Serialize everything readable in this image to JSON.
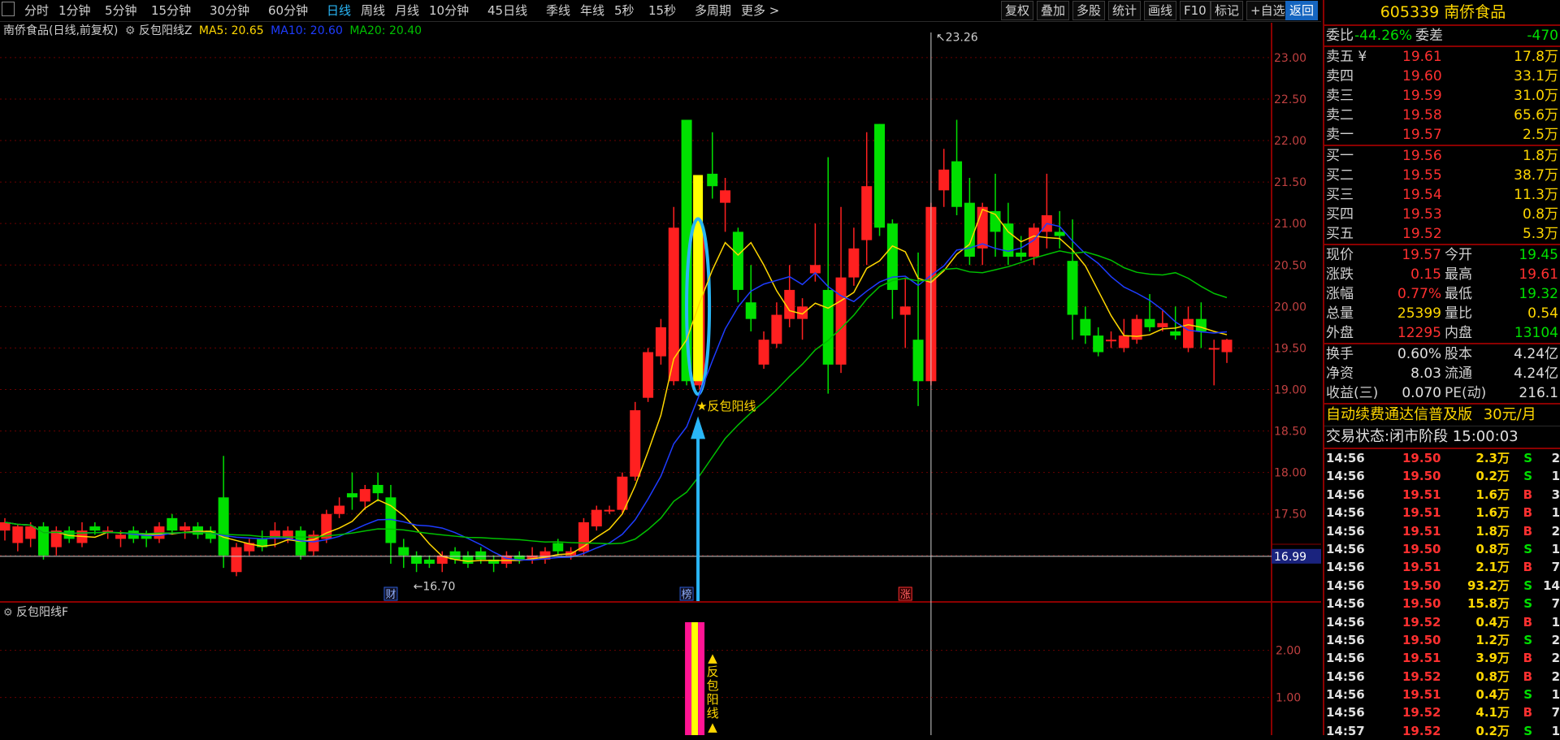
{
  "toolbar": {
    "periods": [
      "分时",
      "1分钟",
      "5分钟",
      "15分钟",
      "30分钟",
      "60分钟",
      "日线",
      "周线",
      "月线",
      "10分钟",
      "45日线",
      "季线",
      "年线",
      "5秒",
      "15秒",
      "多周期",
      "更多 >"
    ],
    "active_period": "日线",
    "right_buttons": [
      "复权",
      "叠加",
      "多股",
      "统计",
      "画线",
      "F10",
      "标记",
      "+自选",
      "返回"
    ]
  },
  "chart_header": {
    "stock": "南侨食品(日线,前复权)",
    "indicator": "反包阳线Z",
    "ma5": "MA5: 20.65",
    "ma10": "MA10: 20.60",
    "ma20": "MA20: 20.40"
  },
  "sub_header": {
    "indicator": "反包阳线F"
  },
  "colors": {
    "up": "#ff2020",
    "down": "#00e000",
    "ma5": "#ffd700",
    "ma10": "#1e3cff",
    "ma20": "#00c000",
    "signal": "#ffff00",
    "accent": "#29b6f6",
    "grid": "#6a0000"
  },
  "chart_data": {
    "type": "candlestick",
    "y_axis_ticks": [
      "23.00",
      "22.50",
      "22.00",
      "21.50",
      "21.00",
      "20.50",
      "20.00",
      "19.50",
      "19.00",
      "18.50",
      "18.00",
      "17.50",
      "17.00"
    ],
    "ylim": [
      16.45,
      23.4
    ],
    "current_price_tag": "16.99",
    "annotations": {
      "high": "23.26",
      "low": "16.70",
      "signal": "反包阳线"
    },
    "event_markers": [
      "财",
      "榜",
      "涨"
    ],
    "candles": [
      [
        17.3,
        17.4,
        17.18,
        17.45
      ],
      [
        17.15,
        17.35,
        17.05,
        17.38
      ],
      [
        17.2,
        17.35,
        17.1,
        17.4
      ],
      [
        17.35,
        17.0,
        16.95,
        17.4
      ],
      [
        17.1,
        17.3,
        17.0,
        17.35
      ],
      [
        17.3,
        17.2,
        17.15,
        17.35
      ],
      [
        17.15,
        17.3,
        17.1,
        17.4
      ],
      [
        17.35,
        17.3,
        17.25,
        17.4
      ],
      [
        17.3,
        17.3,
        17.2,
        17.35
      ],
      [
        17.2,
        17.25,
        17.1,
        17.3
      ],
      [
        17.3,
        17.2,
        17.15,
        17.35
      ],
      [
        17.25,
        17.2,
        17.1,
        17.3
      ],
      [
        17.2,
        17.35,
        17.15,
        17.4
      ],
      [
        17.45,
        17.3,
        17.25,
        17.5
      ],
      [
        17.3,
        17.35,
        17.2,
        17.4
      ],
      [
        17.35,
        17.25,
        17.2,
        17.4
      ],
      [
        17.3,
        17.2,
        17.15,
        17.35
      ],
      [
        17.7,
        17.0,
        16.85,
        18.2
      ],
      [
        16.8,
        17.1,
        16.75,
        17.15
      ],
      [
        17.05,
        17.15,
        17.0,
        17.2
      ],
      [
        17.2,
        17.1,
        17.05,
        17.3
      ],
      [
        17.2,
        17.3,
        17.1,
        17.4
      ],
      [
        17.2,
        17.3,
        17.15,
        17.35
      ],
      [
        17.3,
        17.0,
        16.95,
        17.35
      ],
      [
        17.05,
        17.25,
        17.0,
        17.3
      ],
      [
        17.2,
        17.5,
        17.15,
        17.55
      ],
      [
        17.5,
        17.6,
        17.45,
        17.7
      ],
      [
        17.75,
        17.7,
        17.55,
        18.0
      ],
      [
        17.65,
        17.8,
        17.55,
        17.85
      ],
      [
        17.85,
        17.75,
        17.65,
        18.0
      ],
      [
        17.7,
        17.15,
        16.9,
        17.85
      ],
      [
        17.1,
        17.0,
        16.85,
        17.2
      ],
      [
        17.0,
        16.9,
        16.8,
        17.05
      ],
      [
        16.95,
        16.9,
        16.85,
        17.0
      ],
      [
        16.9,
        17.0,
        16.8,
        17.05
      ],
      [
        17.05,
        16.95,
        16.9,
        17.1
      ],
      [
        17.0,
        16.9,
        16.85,
        17.05
      ],
      [
        17.05,
        16.95,
        16.9,
        17.1
      ],
      [
        16.95,
        16.9,
        16.8,
        17.0
      ],
      [
        16.9,
        17.0,
        16.85,
        17.05
      ],
      [
        17.0,
        16.95,
        16.9,
        17.05
      ],
      [
        16.95,
        17.0,
        16.9,
        17.1
      ],
      [
        16.95,
        17.05,
        16.9,
        17.1
      ],
      [
        17.15,
        17.05,
        17.0,
        17.2
      ],
      [
        17.0,
        17.05,
        16.95,
        17.1
      ],
      [
        17.05,
        17.4,
        17.0,
        17.45
      ],
      [
        17.35,
        17.55,
        17.3,
        17.6
      ],
      [
        17.55,
        17.55,
        17.5,
        17.6
      ],
      [
        17.55,
        17.95,
        17.5,
        18.0
      ],
      [
        17.95,
        18.75,
        17.9,
        18.85
      ],
      [
        18.9,
        19.45,
        18.85,
        19.5
      ],
      [
        19.4,
        19.75,
        19.3,
        19.85
      ],
      [
        19.1,
        20.95,
        19.05,
        21.2
      ],
      [
        22.25,
        19.1,
        19.05,
        22.25
      ],
      [
        19.05,
        20.95,
        19.0,
        20.95
      ],
      [
        21.6,
        21.45,
        21.3,
        22.1
      ],
      [
        21.25,
        21.4,
        20.9,
        21.55
      ],
      [
        20.9,
        20.2,
        20.05,
        20.95
      ],
      [
        20.05,
        19.85,
        19.7,
        20.5
      ],
      [
        19.3,
        19.6,
        19.25,
        19.7
      ],
      [
        19.55,
        19.9,
        19.5,
        20.05
      ],
      [
        19.85,
        20.2,
        19.75,
        20.5
      ],
      [
        19.85,
        20.0,
        19.6,
        20.1
      ],
      [
        20.4,
        20.5,
        20.3,
        21.0
      ],
      [
        20.2,
        19.3,
        18.95,
        21.8
      ],
      [
        19.3,
        20.35,
        19.2,
        21.2
      ],
      [
        20.35,
        20.7,
        20.25,
        20.95
      ],
      [
        20.8,
        21.45,
        20.5,
        22.1
      ],
      [
        22.2,
        20.95,
        20.85,
        22.2
      ],
      [
        21.0,
        20.2,
        19.85,
        21.05
      ],
      [
        19.9,
        20.0,
        19.5,
        20.35
      ],
      [
        19.6,
        19.1,
        18.8,
        20.65
      ],
      [
        19.1,
        21.2,
        19.05,
        21.25
      ],
      [
        21.4,
        21.65,
        21.2,
        21.9
      ],
      [
        21.75,
        21.2,
        21.1,
        22.25
      ],
      [
        21.25,
        20.6,
        20.5,
        21.55
      ],
      [
        20.7,
        21.2,
        20.5,
        21.25
      ],
      [
        21.15,
        20.9,
        20.6,
        21.6
      ],
      [
        21.0,
        20.6,
        20.5,
        21.25
      ],
      [
        20.65,
        20.6,
        20.55,
        20.85
      ],
      [
        20.6,
        20.95,
        20.5,
        21.0
      ],
      [
        20.9,
        21.1,
        20.7,
        21.6
      ],
      [
        20.9,
        20.85,
        20.7,
        21.15
      ],
      [
        20.55,
        19.9,
        19.6,
        21.05
      ],
      [
        19.85,
        19.65,
        19.55,
        20.0
      ],
      [
        19.65,
        19.45,
        19.4,
        19.75
      ],
      [
        19.6,
        19.6,
        19.5,
        19.7
      ],
      [
        19.5,
        19.65,
        19.45,
        19.85
      ],
      [
        19.6,
        19.85,
        19.55,
        19.9
      ],
      [
        19.85,
        19.75,
        19.7,
        20.15
      ],
      [
        19.75,
        19.8,
        19.7,
        19.95
      ],
      [
        19.7,
        19.65,
        19.6,
        20.0
      ],
      [
        19.5,
        19.85,
        19.45,
        20.0
      ],
      [
        19.85,
        19.7,
        19.5,
        20.05
      ],
      [
        19.5,
        19.5,
        19.05,
        19.6
      ],
      [
        19.45,
        19.6,
        19.32,
        19.61
      ]
    ],
    "sub_axis_ticks": [
      "2.00",
      "1.00"
    ],
    "sub_signal_label": "▲反包阳线▲"
  },
  "quote": {
    "code": "605339",
    "name": "南侨食品",
    "weibi_label": "委比",
    "weibi": "-44.26%",
    "weicha_label": "委差",
    "weicha": "-470",
    "sells": [
      {
        "label": "卖五",
        "mark": "¥",
        "price": "19.61",
        "vol": "17.8万"
      },
      {
        "label": "卖四",
        "price": "19.60",
        "vol": "33.1万"
      },
      {
        "label": "卖三",
        "price": "19.59",
        "vol": "31.0万"
      },
      {
        "label": "卖二",
        "price": "19.58",
        "vol": "65.6万"
      },
      {
        "label": "卖一",
        "price": "19.57",
        "vol": "2.5万"
      }
    ],
    "buys": [
      {
        "label": "买一",
        "price": "19.56",
        "vol": "1.8万"
      },
      {
        "label": "买二",
        "price": "19.55",
        "vol": "38.7万"
      },
      {
        "label": "买三",
        "price": "19.54",
        "vol": "11.3万"
      },
      {
        "label": "买四",
        "price": "19.53",
        "vol": "0.8万"
      },
      {
        "label": "买五",
        "price": "19.52",
        "vol": "5.3万"
      }
    ],
    "stats": [
      {
        "l1": "现价",
        "v1": "19.57",
        "c1": "red",
        "l2": "今开",
        "v2": "19.45",
        "c2": "green"
      },
      {
        "l1": "涨跌",
        "v1": "0.15",
        "c1": "red",
        "l2": "最高",
        "v2": "19.61",
        "c2": "red"
      },
      {
        "l1": "涨幅",
        "v1": "0.77%",
        "c1": "red",
        "l2": "最低",
        "v2": "19.32",
        "c2": "green"
      },
      {
        "l1": "总量",
        "v1": "25399",
        "c1": "yellow",
        "l2": "量比",
        "v2": "0.54",
        "c2": "yellow"
      },
      {
        "l1": "外盘",
        "v1": "12295",
        "c1": "red",
        "l2": "内盘",
        "v2": "13104",
        "c2": "green"
      }
    ],
    "stats2": [
      {
        "l1": "换手",
        "v1": "0.60%",
        "l2": "股本",
        "v2": "4.24亿"
      },
      {
        "l1": "净资",
        "v1": "8.03",
        "l2": "流通",
        "v2": "4.24亿"
      },
      {
        "l1": "收益(三)",
        "v1": "0.070",
        "l2": "PE(动)",
        "v2": "216.1"
      }
    ],
    "promo": "自动续费通达信普及版",
    "promo_price": "30元/月",
    "status": "交易状态:闭市阶段 15:00:03"
  },
  "ticks": [
    {
      "t": "14:56",
      "p": "19.50",
      "v": "2.3万",
      "s": "S",
      "n": "2"
    },
    {
      "t": "14:56",
      "p": "19.50",
      "v": "0.2万",
      "s": "S",
      "n": "1"
    },
    {
      "t": "14:56",
      "p": "19.51",
      "v": "1.6万",
      "s": "B",
      "n": "3"
    },
    {
      "t": "14:56",
      "p": "19.51",
      "v": "1.6万",
      "s": "B",
      "n": "1"
    },
    {
      "t": "14:56",
      "p": "19.51",
      "v": "1.8万",
      "s": "B",
      "n": "2"
    },
    {
      "t": "14:56",
      "p": "19.50",
      "v": "0.8万",
      "s": "S",
      "n": "1"
    },
    {
      "t": "14:56",
      "p": "19.51",
      "v": "2.1万",
      "s": "B",
      "n": "7"
    },
    {
      "t": "14:56",
      "p": "19.50",
      "v": "93.2万",
      "s": "S",
      "n": "14"
    },
    {
      "t": "14:56",
      "p": "19.50",
      "v": "15.8万",
      "s": "S",
      "n": "7"
    },
    {
      "t": "14:56",
      "p": "19.52",
      "v": "0.4万",
      "s": "B",
      "n": "1"
    },
    {
      "t": "14:56",
      "p": "19.50",
      "v": "1.2万",
      "s": "S",
      "n": "2"
    },
    {
      "t": "14:56",
      "p": "19.51",
      "v": "3.9万",
      "s": "B",
      "n": "2"
    },
    {
      "t": "14:56",
      "p": "19.52",
      "v": "0.8万",
      "s": "B",
      "n": "2"
    },
    {
      "t": "14:56",
      "p": "19.51",
      "v": "0.4万",
      "s": "S",
      "n": "1"
    },
    {
      "t": "14:56",
      "p": "19.52",
      "v": "4.1万",
      "s": "B",
      "n": "7"
    },
    {
      "t": "14:57",
      "p": "19.52",
      "v": "0.2万",
      "s": "S",
      "n": "1"
    }
  ]
}
